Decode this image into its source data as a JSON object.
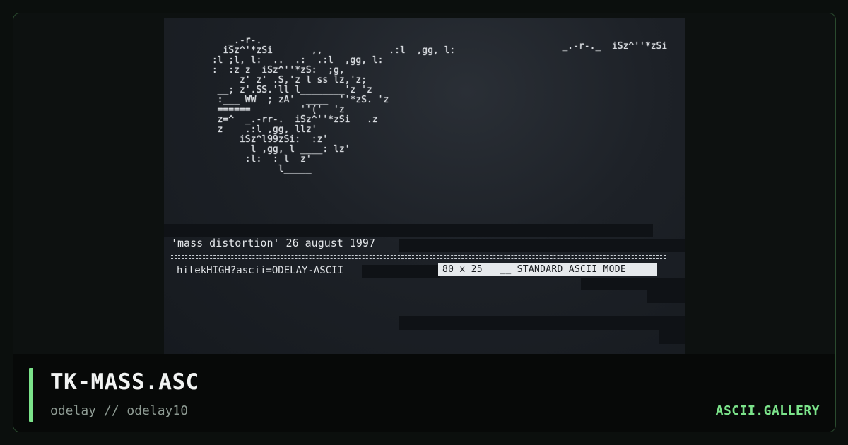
{
  "artwork": {
    "ascii_main": "    _.-r-.\n   iSz^'*zSi       ,,            .:l  ,gg, l:\n :l ;l, l:  ..  .:  .:l  ,gg, l:\n :  :z z  iSz^''*zS:  ;g,\n      z' z' .S,'z l ss lz,'z;\n  __; z'.SS.'ll l________'z 'z\n  :___ WW  ; zA'  ____  ''*zS. 'z\n  ======         ''('  'z\n  z=^  _.-rr-.  iSz^''*zSi   .z\n  z    .:l ,gg, llz'\n      iSz^l99zSi:  :z'\n        l ,gg, l ____: lz'\n       :l:  : l  z'\n             l_____",
    "ascii_right": "                                 _.-r-.\n   _.-r-._  iSz^''*zSi",
    "caption": "'mass distortion' 26 august 1997",
    "credit": "hitekHIGH?ascii=ODELAY-ASCII",
    "mode_label": "80 x 25   __ STANDARD ASCII MODE"
  },
  "footer": {
    "title": "TK-MASS.ASC",
    "author": "odelay // odelay10",
    "brand": "ASCII.GALLERY"
  },
  "colors": {
    "accent": "#7be38a",
    "background": "#0b0f0d",
    "panel": "#1d2127"
  }
}
